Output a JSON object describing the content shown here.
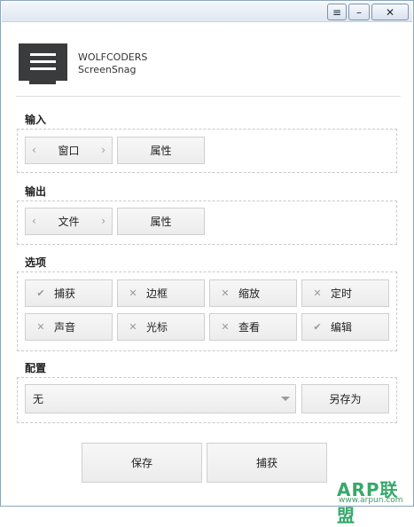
{
  "window": {
    "menu_glyph": "≡",
    "minimize_glyph": "–",
    "close_glyph": "✕"
  },
  "brand": {
    "line1": "WOLFCODERS",
    "line2": "ScreenSnag"
  },
  "sections": {
    "input": {
      "title": "输入",
      "value": "窗口",
      "prev_arrow": "‹",
      "next_arrow": "›",
      "props_label": "属性"
    },
    "output": {
      "title": "输出",
      "value": "文件",
      "prev_arrow": "‹",
      "next_arrow": "›",
      "props_label": "属性"
    },
    "options": {
      "title": "选项",
      "items": [
        {
          "label": "捕获",
          "checked": true,
          "mark": "✔"
        },
        {
          "label": "边框",
          "checked": false,
          "mark": "✕"
        },
        {
          "label": "缩放",
          "checked": false,
          "mark": "✕"
        },
        {
          "label": "定时",
          "checked": false,
          "mark": "✕"
        },
        {
          "label": "声音",
          "checked": false,
          "mark": "✕"
        },
        {
          "label": "光标",
          "checked": false,
          "mark": "✕"
        },
        {
          "label": "查看",
          "checked": false,
          "mark": "✕"
        },
        {
          "label": "编辑",
          "checked": true,
          "mark": "✔"
        }
      ]
    },
    "config": {
      "title": "配置",
      "selected": "无",
      "save_as_label": "另存为"
    }
  },
  "actions": {
    "save_label": "保存",
    "capture_label": "捕获"
  },
  "watermark": {
    "text": "ARP联盟",
    "url": "www.arpun.com"
  },
  "colors": {
    "watermark": "#37a86b",
    "logo": "#3a3b3d"
  }
}
